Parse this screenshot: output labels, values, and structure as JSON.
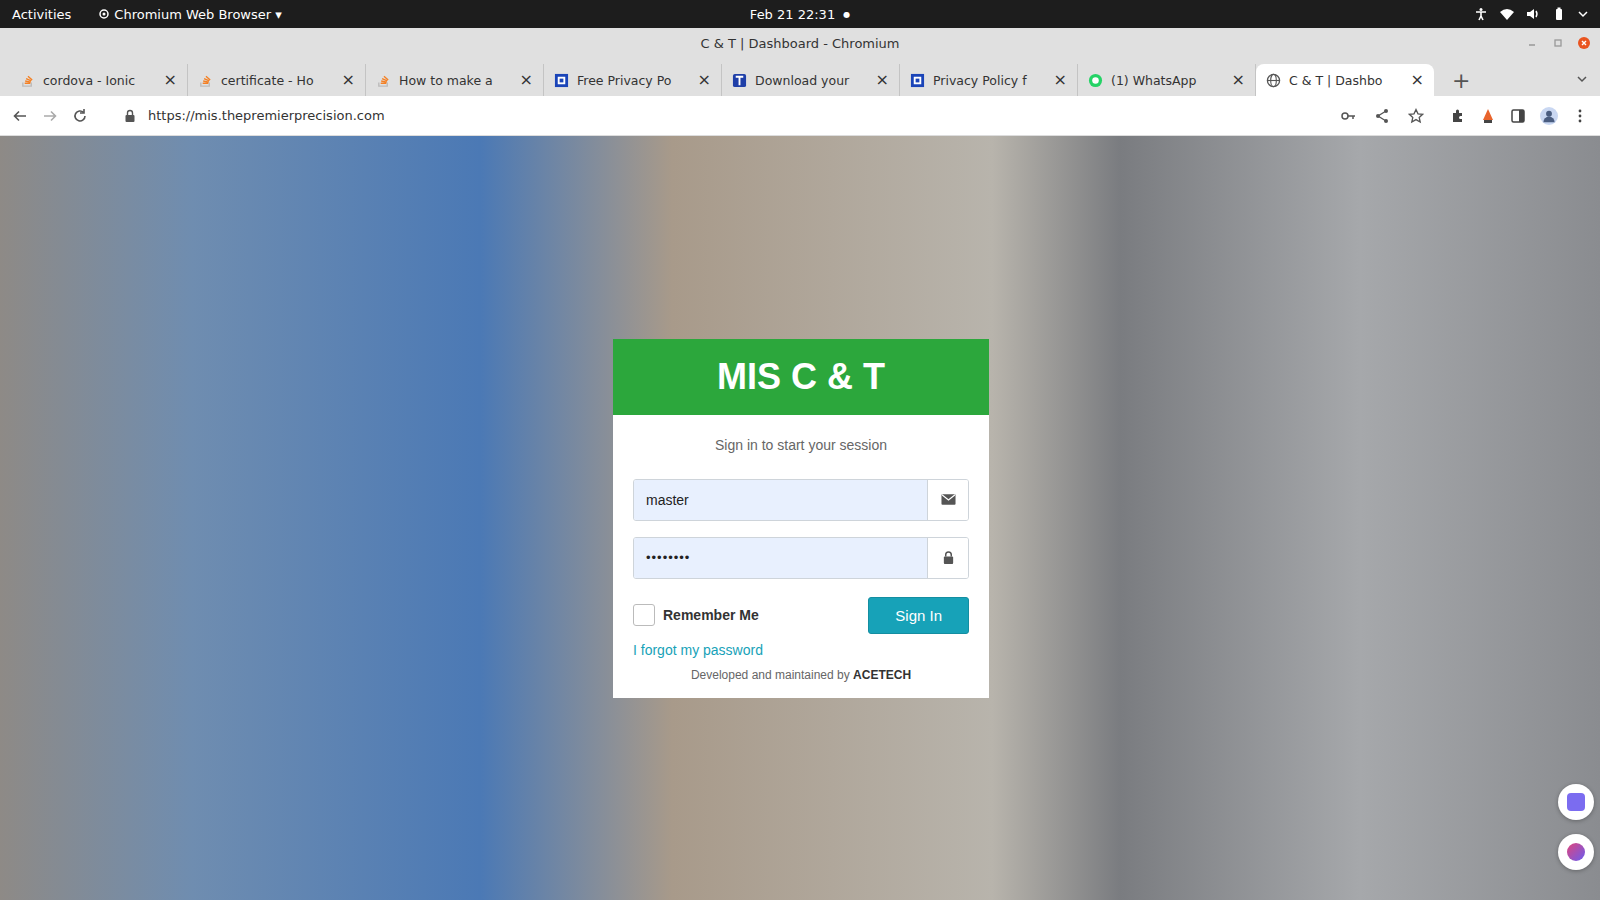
{
  "topbar": {
    "activities": "Activities",
    "app": "Chromium Web Browser",
    "app_arrow": "▾",
    "clock": "Feb 21  22:31",
    "clock_dot": "●"
  },
  "window": {
    "title": "C & T | Dashboard - Chromium"
  },
  "tabs": [
    {
      "label": "cordova - Ionic",
      "selected": false,
      "kind": "stack"
    },
    {
      "label": "certificate - Ho",
      "selected": false,
      "kind": "stack"
    },
    {
      "label": "How to make a",
      "selected": false,
      "kind": "stack"
    },
    {
      "label": "Free Privacy Po",
      "selected": false,
      "kind": "termly"
    },
    {
      "label": "Download your",
      "selected": false,
      "kind": "doc"
    },
    {
      "label": "Privacy Policy f",
      "selected": false,
      "kind": "termly"
    },
    {
      "label": "(1) WhatsApp",
      "selected": false,
      "kind": "whatsapp"
    },
    {
      "label": "C & T | Dashbo",
      "selected": true,
      "kind": "globe"
    }
  ],
  "tab_close": "×",
  "new_tab": "+",
  "address_bar": {
    "url": "https://mis.thepremierprecision.com"
  },
  "login": {
    "title": "MIS C & T",
    "subtitle": "Sign in to start your session",
    "username": "master",
    "password": "••••••••",
    "remember": {
      "label": "Remember Me",
      "checked": false
    },
    "sign_in": "Sign In",
    "forgot": "I forgot my password",
    "footer": "Developed and maintained by",
    "footer_brand": "ACETECH"
  }
}
